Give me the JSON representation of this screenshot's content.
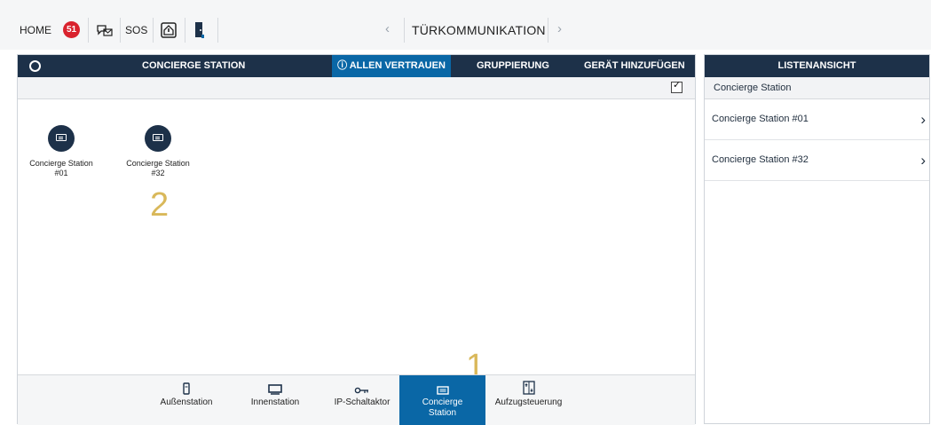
{
  "topbar": {
    "home_label": "HOME",
    "notifications_count": "51",
    "sos_label": "SOS",
    "nav_title": "TÜRKOMMUNIKATION",
    "prev_glyph": "‹",
    "next_glyph": "›"
  },
  "main": {
    "header": {
      "title": "CONCIERGE STATION",
      "trust_all": "ⓘ ALLEN VERTRAUEN",
      "grouping": "GRUPPIERUNG",
      "add_device": "GERÄT HINZUFÜGEN"
    },
    "devices": [
      {
        "line1": "Concierge Station",
        "line2": "#01"
      },
      {
        "line1": "Concierge Station",
        "line2": "#32"
      }
    ],
    "annotations": [
      "1",
      "2"
    ],
    "tabs": [
      {
        "label": "Außenstation",
        "icon": "outdoor-station-icon"
      },
      {
        "label": "Innenstation",
        "icon": "indoor-station-icon"
      },
      {
        "label": "IP-Schaltaktor",
        "icon": "key-icon"
      },
      {
        "label_line1": "Concierge",
        "label_line2": "Station",
        "icon": "concierge-station-icon"
      },
      {
        "label": "Aufzugsteuerung",
        "icon": "elevator-icon"
      }
    ]
  },
  "side": {
    "title": "LISTENANSICHT",
    "subheader": "Concierge Station",
    "items": [
      {
        "label": "Concierge Station #01"
      },
      {
        "label": "Concierge Station #32"
      }
    ]
  },
  "colors": {
    "navy": "#1d3149",
    "active_blue": "#0a67a6",
    "badge_red": "#d9232e",
    "annotation_gold": "#d9b85a"
  }
}
